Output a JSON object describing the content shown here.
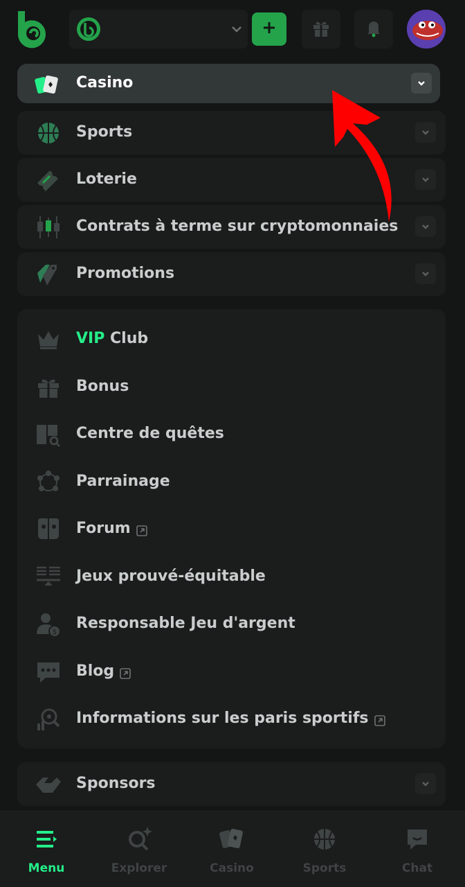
{
  "colors": {
    "background": "#141515",
    "panel": "#1b1c1c",
    "active_panel": "#323737",
    "accent": "#24ee89",
    "deposit_button": "#24a34b",
    "arrow": "#ff0000"
  },
  "header": {
    "logo_icon": "bc-logo-icon",
    "wallet_coin_icon": "bc-coin-icon",
    "wallet_chevron_icon": "chevron-down-icon",
    "deposit_icon": "plus-icon",
    "gift_icon": "gift-icon",
    "bell_icon": "bell-icon",
    "avatar_icon": "user-avatar"
  },
  "menu_groups": [
    {
      "label": "Casino",
      "icon": "casino-cards-icon",
      "active": true
    },
    {
      "label": "Sports",
      "icon": "basketball-icon",
      "active": false
    },
    {
      "label": "Loterie",
      "icon": "ticket-icon",
      "active": false
    },
    {
      "label": "Contrats à terme sur cryptomonnaies",
      "icon": "candlestick-icon",
      "active": false
    },
    {
      "label": "Promotions",
      "icon": "tags-icon",
      "active": false
    }
  ],
  "links": [
    {
      "label_accent": "VIP",
      "label": " Club",
      "icon": "crown-icon",
      "external": false
    },
    {
      "label": "Bonus",
      "icon": "gift-icon",
      "external": false
    },
    {
      "label": "Centre de quêtes",
      "icon": "quest-book-icon",
      "external": false
    },
    {
      "label": "Parrainage",
      "icon": "referral-circle-icon",
      "external": false
    },
    {
      "label": "Forum",
      "icon": "forum-icon",
      "external": true
    },
    {
      "label": "Jeux prouvé-équitable",
      "icon": "provably-fair-icon",
      "external": false
    },
    {
      "label": "Responsable Jeu d'argent",
      "icon": "responsible-gambling-icon",
      "external": false
    },
    {
      "label": "Blog",
      "icon": "chat-bubble-icon",
      "external": true
    },
    {
      "label": "Informations sur les paris sportifs",
      "icon": "sports-info-icon",
      "external": true
    }
  ],
  "sponsors": {
    "label": "Sponsors",
    "icon": "handshake-icon"
  },
  "bottom_nav": [
    {
      "label": "Menu",
      "icon": "menu-icon",
      "active": true
    },
    {
      "label": "Explorer",
      "icon": "search-sparkle-icon",
      "active": false
    },
    {
      "label": "Casino",
      "icon": "casino-cards-icon",
      "active": false
    },
    {
      "label": "Sports",
      "icon": "basketball-icon",
      "active": false
    },
    {
      "label": "Chat",
      "icon": "chat-icon",
      "active": false
    }
  ]
}
